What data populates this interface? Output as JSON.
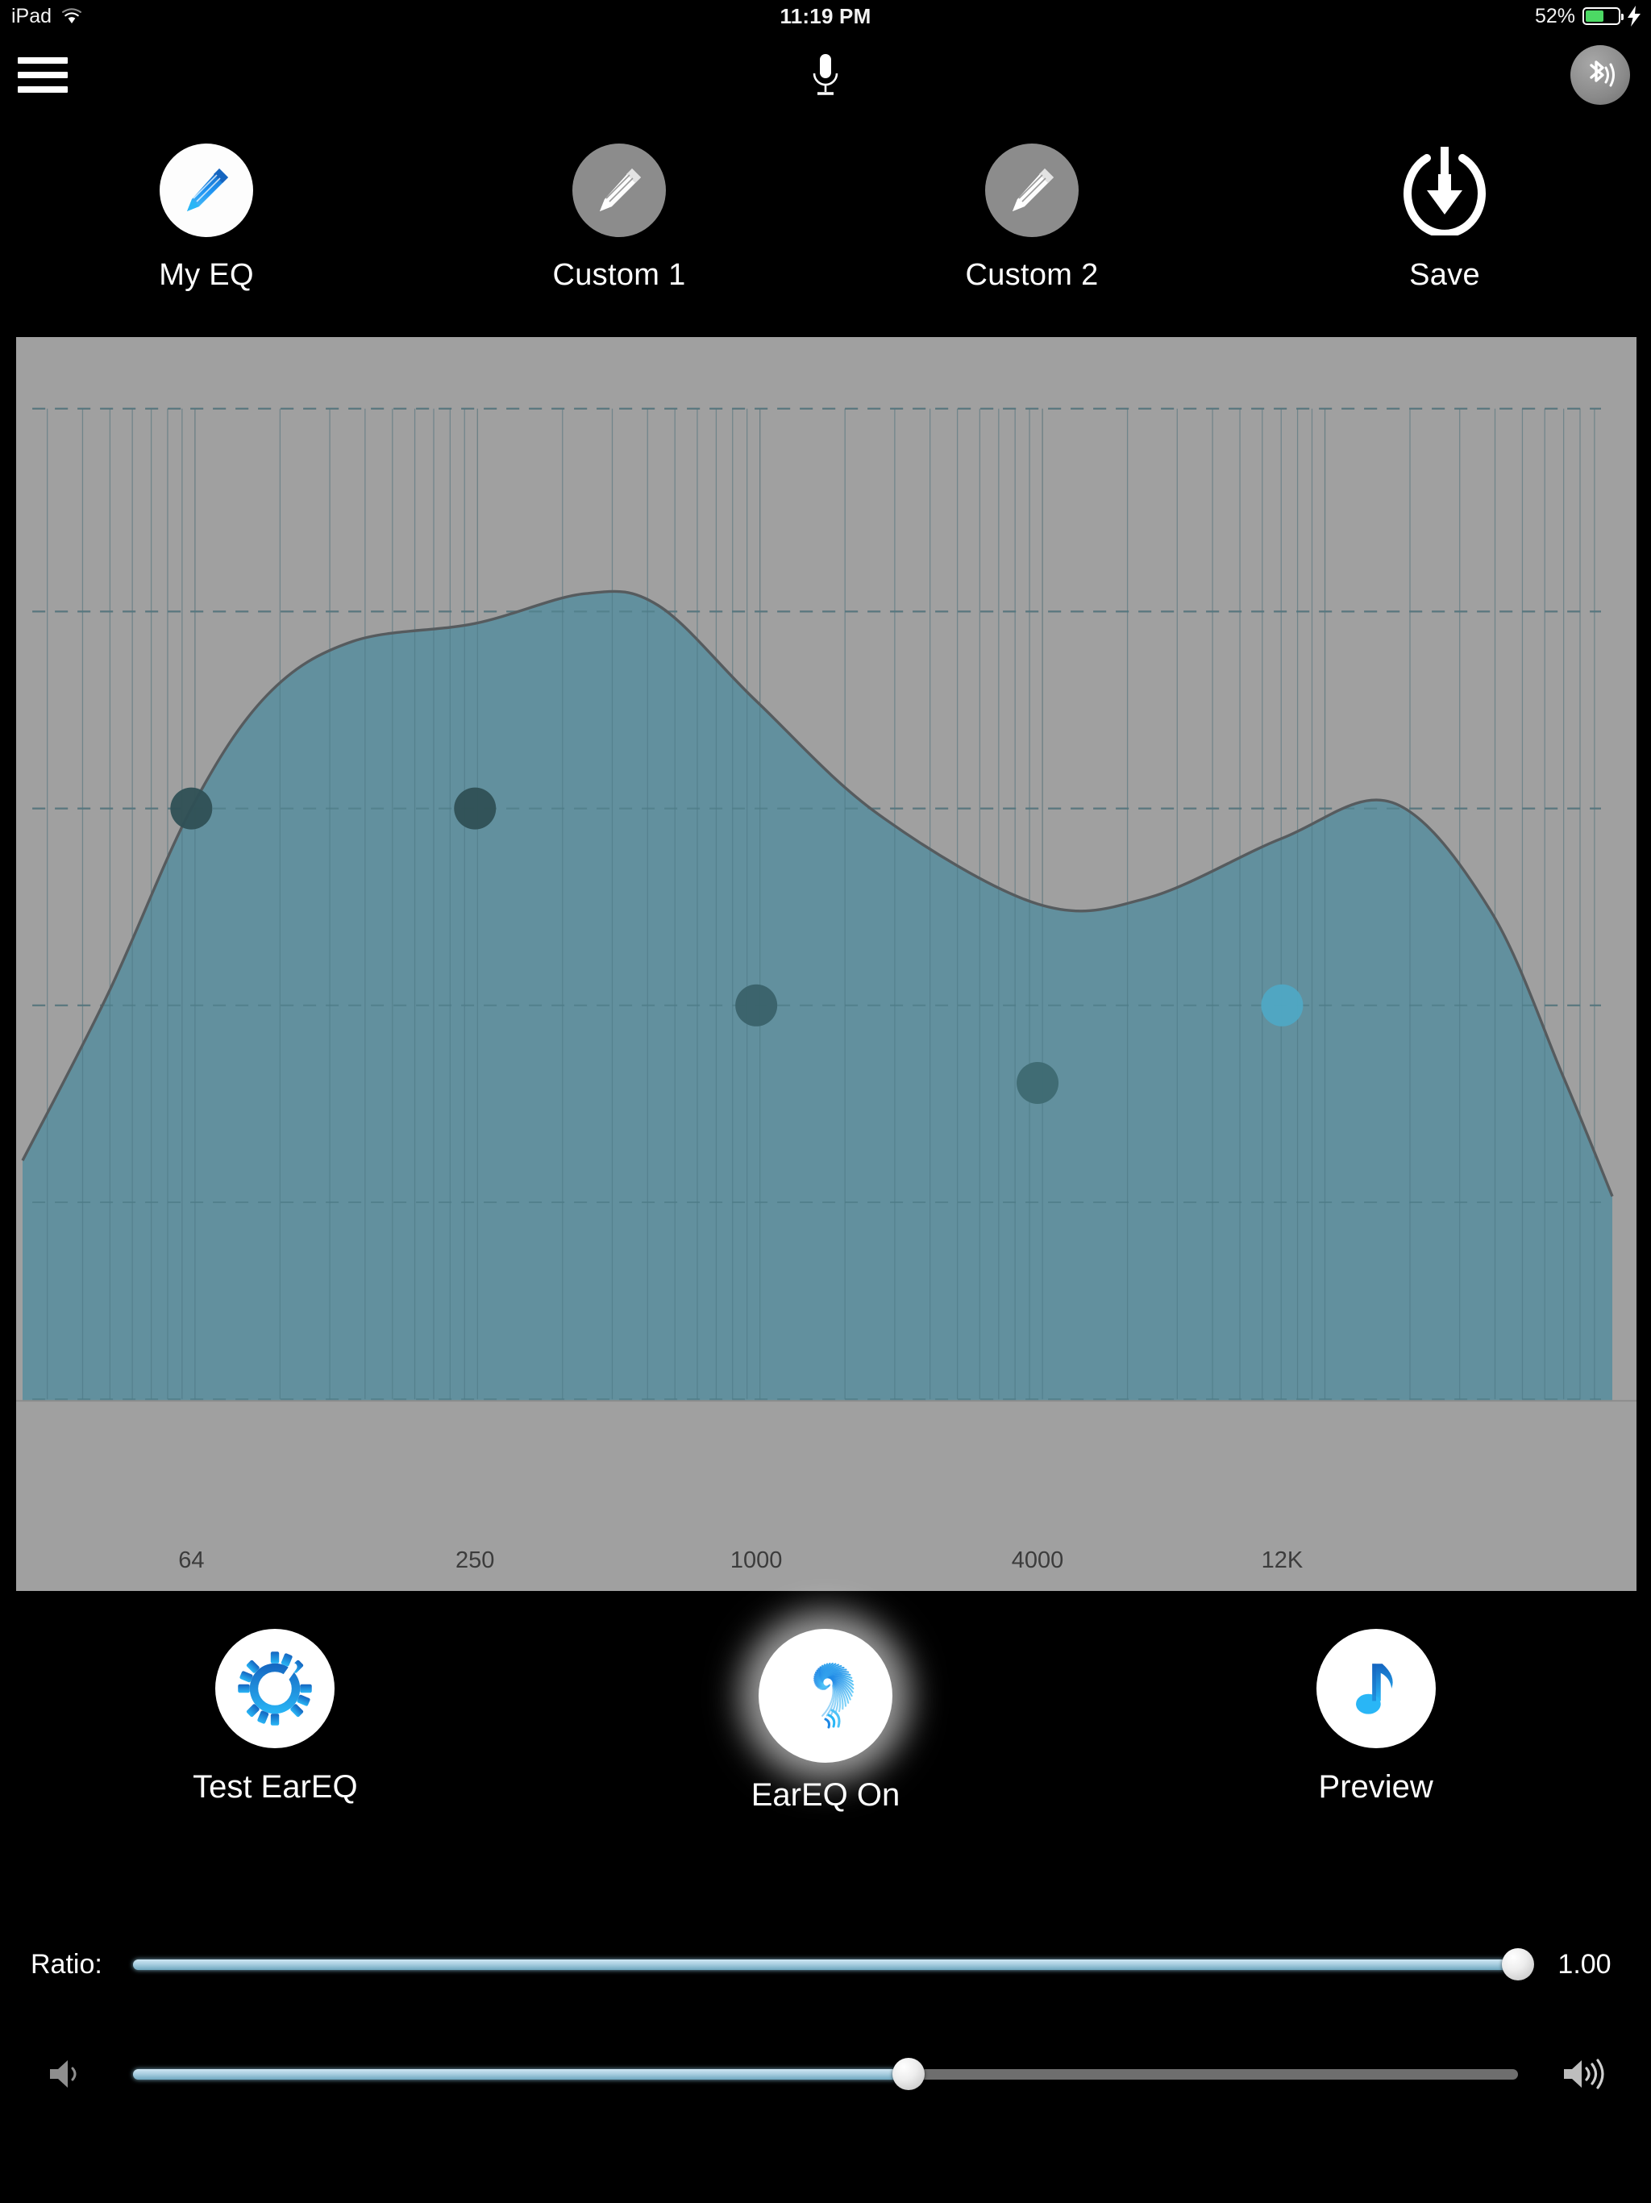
{
  "status_bar": {
    "device": "iPad",
    "wifi_icon": "wifi-icon",
    "time": "11:19 PM",
    "battery_percent": "52%",
    "battery_level": 52,
    "charging_icon": "lightning-bolt-icon",
    "battery_color": "#4cd964"
  },
  "top_bar": {
    "menu_icon": "hamburger-menu-icon",
    "mic_icon": "microphone-icon",
    "bluetooth_icon": "bluetooth-audio-icon"
  },
  "presets": [
    {
      "label": "My EQ",
      "icon": "pencil-icon",
      "state": "active"
    },
    {
      "label": "Custom 1",
      "icon": "pencil-icon",
      "state": "inactive"
    },
    {
      "label": "Custom 2",
      "icon": "pencil-icon",
      "state": "inactive"
    },
    {
      "label": "Save",
      "icon": "save-power-download-icon",
      "state": "bare"
    }
  ],
  "chart_data": {
    "type": "area",
    "title": "",
    "xlabel": "",
    "ylabel": "",
    "x_scale": "log",
    "grid": true,
    "legend": false,
    "background_color": "#a0a0a0",
    "fill_color": "#5e8e9d",
    "line_color": "#565b5e",
    "xticks": [
      {
        "label": "64",
        "pos_pct": 6.9
      },
      {
        "label": "250",
        "pos_pct": 18.5
      },
      {
        "label": "1000",
        "pos_pct": 30.0
      },
      {
        "label": "4000",
        "pos_pct": 41.5
      },
      {
        "label": "12K",
        "pos_pct": 51.5
      }
    ],
    "x": [
      64,
      250,
      1000,
      4000,
      12000
    ],
    "hgridlines_pct": [
      6.0,
      23.0,
      39.5,
      56.0,
      72.5,
      89.0
    ],
    "curve_points_pct": [
      {
        "x": 0.0,
        "y": 69.0
      },
      {
        "x": 3.5,
        "y": 55.0
      },
      {
        "x": 6.9,
        "y": 39.5
      },
      {
        "x": 10.0,
        "y": 30.0
      },
      {
        "x": 13.5,
        "y": 25.5
      },
      {
        "x": 18.5,
        "y": 24.0
      },
      {
        "x": 23.0,
        "y": 21.5
      },
      {
        "x": 26.0,
        "y": 22.5
      },
      {
        "x": 30.0,
        "y": 30.5
      },
      {
        "x": 35.0,
        "y": 40.0
      },
      {
        "x": 41.5,
        "y": 47.5
      },
      {
        "x": 46.0,
        "y": 47.0
      },
      {
        "x": 51.5,
        "y": 42.0
      },
      {
        "x": 56.0,
        "y": 39.0
      },
      {
        "x": 60.0,
        "y": 48.0
      },
      {
        "x": 63.0,
        "y": 62.0
      },
      {
        "x": 65.0,
        "y": 72.0
      }
    ],
    "control_points": [
      {
        "x_pct": 6.9,
        "y_pct": 39.5,
        "color": "#2f5055"
      },
      {
        "x_pct": 18.5,
        "y_pct": 39.5,
        "color": "#2f5055"
      },
      {
        "x_pct": 30.0,
        "y_pct": 56.0,
        "color": "#3a626a"
      },
      {
        "x_pct": 41.5,
        "y_pct": 62.5,
        "color": "#3e6a72"
      },
      {
        "x_pct": 51.5,
        "y_pct": 56.0,
        "color": "#4fa8c4"
      }
    ]
  },
  "actions": [
    {
      "label": "Test EarEQ",
      "icon": "gear-check-icon",
      "glow": false
    },
    {
      "label": "EarEQ On",
      "icon": "eareq-spiral-icon",
      "glow": true
    },
    {
      "label": "Preview",
      "icon": "music-note-icon",
      "glow": false
    }
  ],
  "sliders": {
    "ratio": {
      "label": "Ratio:",
      "value_text": "1.00",
      "fill_percent": 100
    },
    "volume": {
      "left_icon": "speaker-low-icon",
      "right_icon": "speaker-high-icon",
      "fill_percent": 56
    }
  },
  "colors": {
    "accent_blue": "#1e9ce0",
    "slider_fill": "#a9cfe1",
    "track": "#6e6e6e"
  }
}
